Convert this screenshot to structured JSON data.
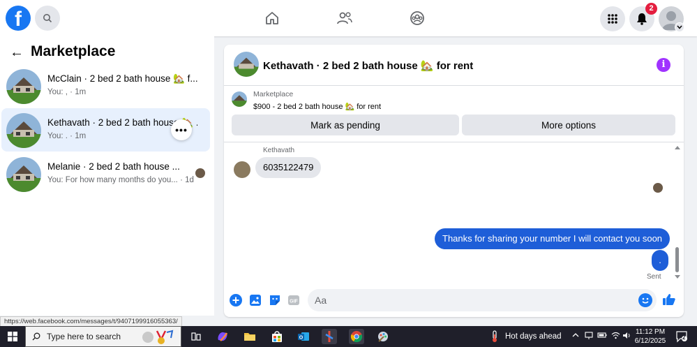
{
  "nav": {
    "logo": "f",
    "notifications_count": "2"
  },
  "left": {
    "title": "Marketplace",
    "conversations": [
      {
        "title": "McClain · 2 bed 2 bath house 🏡 f...",
        "subtitle": "You: , · 1m"
      },
      {
        "title": "Kethavath · 2 bed 2 bath house 🏡 ...",
        "subtitle": "You: . · 1m"
      },
      {
        "title": "Melanie · 2 bed 2 bath house ...",
        "subtitle": "You: For how many months do you... · 1d"
      }
    ]
  },
  "chat": {
    "title": "Kethavath · 2 bed 2 bath house 🏡 for rent",
    "listing_source": "Marketplace",
    "listing_desc": "$900 - 2 bed 2 bath house 🏡 for rent",
    "mark_pending": "Mark as pending",
    "more_options": "More options",
    "sender": "Kethavath",
    "incoming_message": "6035122479",
    "outgoing_message_1": "Thanks for sharing your number I will contact you soon",
    "outgoing_message_2": ".",
    "sent_status": "Sent",
    "composer_placeholder": "Aa"
  },
  "status_url": "https://web.facebook.com/messages/t/9407199916055363/",
  "taskbar": {
    "search_placeholder": "Type here to search",
    "weather": "Hot days ahead",
    "time": "11:12 PM",
    "date": "6/12/2025",
    "notif_count": "2"
  }
}
